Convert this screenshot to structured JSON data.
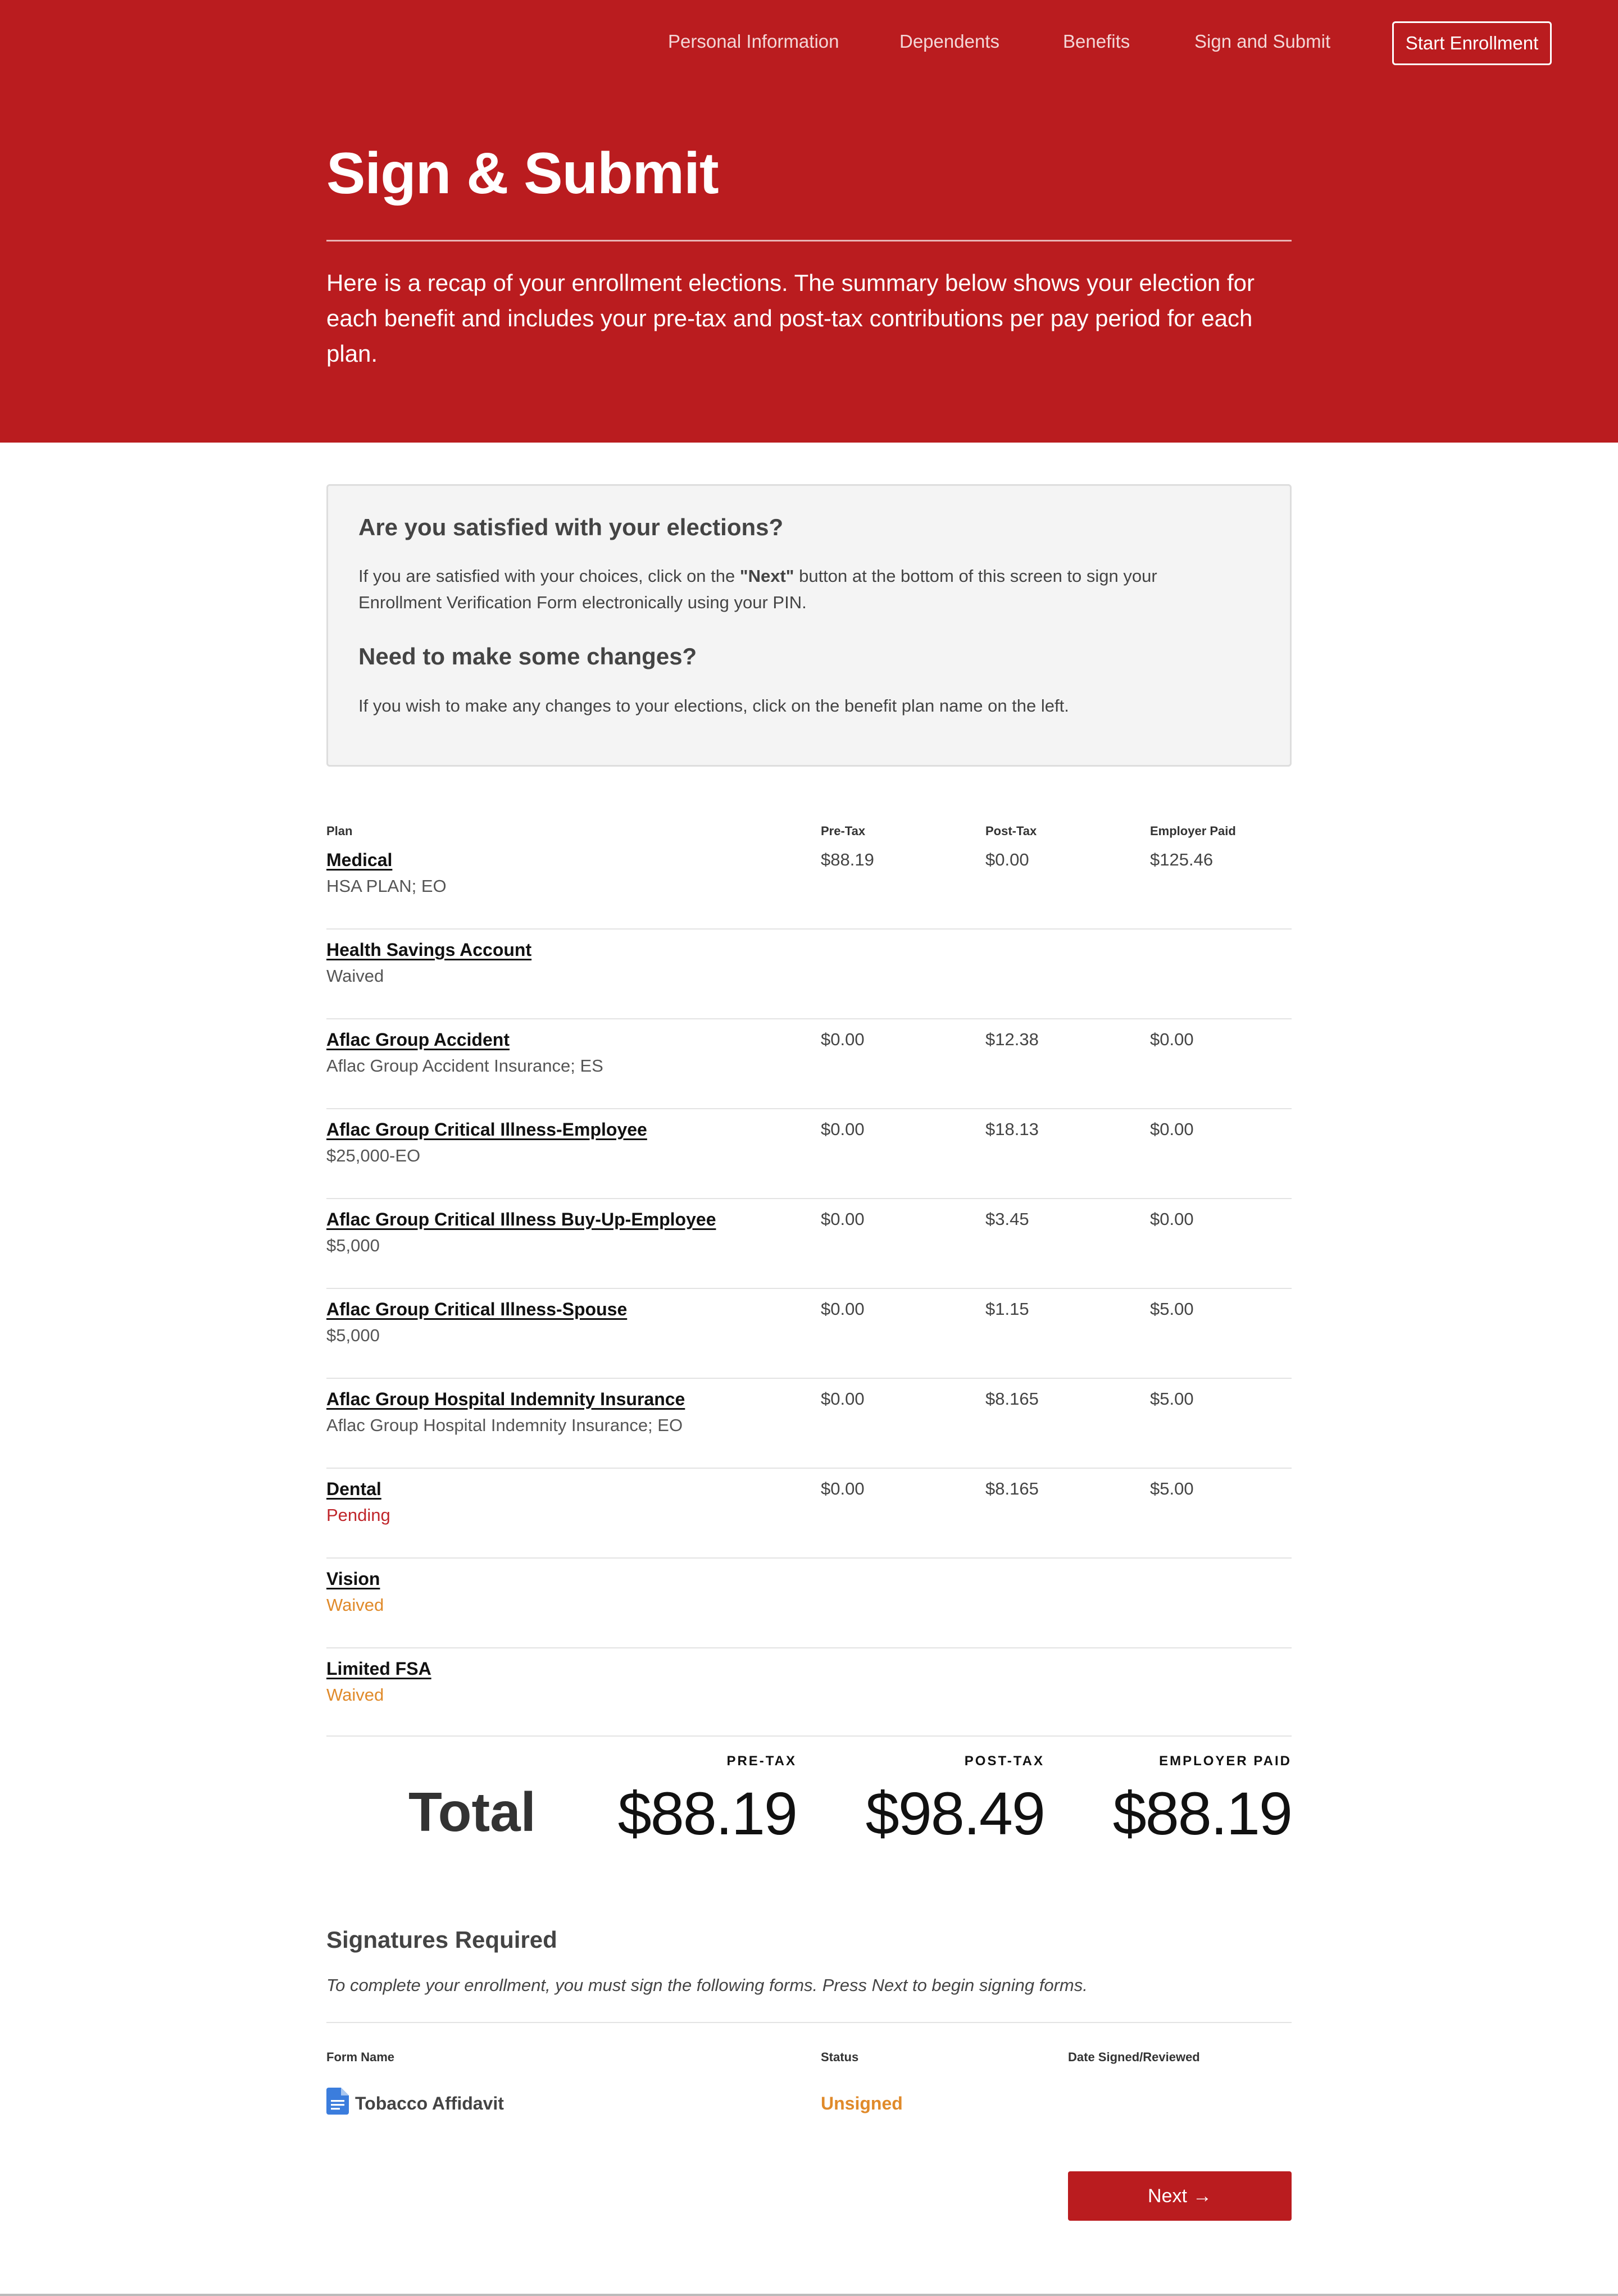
{
  "nav": {
    "items": [
      "Personal Information",
      "Dependents",
      "Benefits",
      "Sign and Submit"
    ],
    "cta": "Start Enrollment"
  },
  "hero": {
    "title": "Sign & Submit",
    "text": "Here is a recap of your enrollment elections. The summary below shows your election for each benefit and includes your pre-tax and post-tax contributions per pay period for each plan."
  },
  "info": {
    "heading1": "Are you satisfied with your elections?",
    "p1_before": "If you are satisfied with your choices, click on the ",
    "p1_bold": "\"Next\"",
    "p1_after": " button at the bottom of this screen to sign your Enrollment Verification Form electronically using your PIN.",
    "heading2": "Need to make some changes?",
    "p2": "If you wish to make any changes to your elections, click on the benefit plan name on the left."
  },
  "table": {
    "headers": [
      "Plan",
      "Pre-Tax",
      "Post-Tax",
      "Employer Paid"
    ],
    "rows": [
      {
        "name": "Medical",
        "sub": "HSA PLAN; EO",
        "pre": "$88.19",
        "post": "$0.00",
        "employer": "$125.46"
      },
      {
        "name": "Health Savings Account",
        "sub": "Waived",
        "pre": "",
        "post": "",
        "employer": ""
      },
      {
        "name": "Aflac Group Accident",
        "sub": "Aflac Group Accident Insurance; ES",
        "pre": "$0.00",
        "post": "$12.38",
        "employer": "$0.00"
      },
      {
        "name": "Aflac Group Critical Illness-Employee",
        "sub": "$25,000-EO",
        "pre": "$0.00",
        "post": "$18.13",
        "employer": "$0.00"
      },
      {
        "name": "Aflac Group Critical Illness Buy-Up-Employee",
        "sub": "$5,000",
        "pre": "$0.00",
        "post": "$3.45",
        "employer": "$0.00"
      },
      {
        "name": "Aflac Group Critical Illness-Spouse",
        "sub": "$5,000",
        "pre": "$0.00",
        "post": "$1.15",
        "employer": "$5.00"
      },
      {
        "name": "Aflac Group Hospital Indemnity Insurance",
        "sub": "Aflac Group Hospital Indemnity Insurance; EO",
        "pre": "$0.00",
        "post": "$8.165",
        "employer": "$5.00"
      },
      {
        "name": "Dental",
        "sub": "Pending",
        "pre": "$0.00",
        "post": "$8.165",
        "employer": "$5.00"
      },
      {
        "name": "Vision",
        "sub": "Waived",
        "pre": "",
        "post": "",
        "employer": ""
      },
      {
        "name": "Limited FSA",
        "sub": "Waived",
        "pre": "",
        "post": "",
        "employer": ""
      }
    ]
  },
  "totals": {
    "label": "Total",
    "pre_label": "PRE-TAX",
    "post_label": "POST-TAX",
    "employer_label": "EMPLOYER PAID",
    "pre": "$88.19",
    "post": "$98.49",
    "employer": "$88.19"
  },
  "signatures": {
    "title": "Signatures Required",
    "description": "To complete your enrollment, you must sign the following forms. Press Next to begin signing forms.",
    "headers": [
      "Form Name",
      "Status",
      "Date Signed/Reviewed"
    ],
    "forms": [
      {
        "name": "Tobacco Affidavit",
        "status": "Unsigned",
        "date": ""
      }
    ]
  },
  "next_button": "Next",
  "colors": {
    "brand_red": "#ba1c1f",
    "pending": "#c0262b",
    "warning_orange": "#e08a2a"
  }
}
